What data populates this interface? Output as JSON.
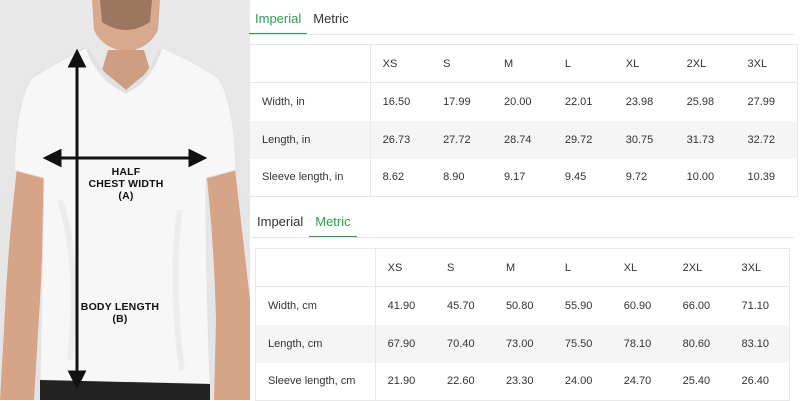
{
  "diagram": {
    "chest_label_line1": "HALF",
    "chest_label_line2": "CHEST WIDTH",
    "chest_label_line3": "(A)",
    "length_label_line1": "BODY LENGTH",
    "length_label_line2": "(B)"
  },
  "colors": {
    "accent": "#2e9e4e",
    "row_shade": "#f5f5f5",
    "border": "#e8e8e8"
  },
  "imperial_panel": {
    "tabs": [
      {
        "label": "Imperial",
        "active": true
      },
      {
        "label": "Metric",
        "active": false
      }
    ],
    "sizes": [
      "XS",
      "S",
      "M",
      "L",
      "XL",
      "2XL",
      "3XL"
    ],
    "rows": [
      {
        "label": "Width, in",
        "values": [
          "16.50",
          "17.99",
          "20.00",
          "22.01",
          "23.98",
          "25.98",
          "27.99"
        ]
      },
      {
        "label": "Length, in",
        "values": [
          "26.73",
          "27.72",
          "28.74",
          "29.72",
          "30.75",
          "31.73",
          "32.72"
        ]
      },
      {
        "label": "Sleeve length, in",
        "values": [
          "8.62",
          "8.90",
          "9.17",
          "9.45",
          "9.72",
          "10.00",
          "10.39"
        ]
      }
    ]
  },
  "metric_panel": {
    "tabs": [
      {
        "label": "Imperial",
        "active": false
      },
      {
        "label": "Metric",
        "active": true
      }
    ],
    "sizes": [
      "XS",
      "S",
      "M",
      "L",
      "XL",
      "2XL",
      "3XL"
    ],
    "rows": [
      {
        "label": "Width, cm",
        "values": [
          "41.90",
          "45.70",
          "50.80",
          "55.90",
          "60.90",
          "66.00",
          "71.10"
        ]
      },
      {
        "label": "Length, cm",
        "values": [
          "67.90",
          "70.40",
          "73.00",
          "75.50",
          "78.10",
          "80.60",
          "83.10"
        ]
      },
      {
        "label": "Sleeve length, cm",
        "values": [
          "21.90",
          "22.60",
          "23.30",
          "24.00",
          "24.70",
          "25.40",
          "26.40"
        ]
      }
    ]
  }
}
